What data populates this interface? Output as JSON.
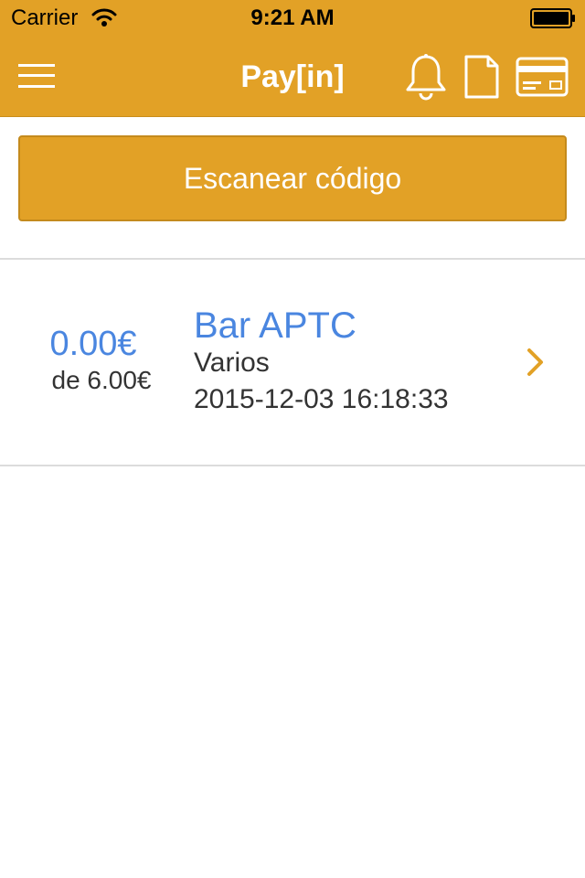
{
  "status_bar": {
    "carrier": "Carrier",
    "time": "9:21 AM",
    "icons": [
      "wifi-icon",
      "battery-icon"
    ]
  },
  "nav": {
    "title": "Pay[in]",
    "icons": [
      "menu-icon",
      "bell-icon",
      "document-icon",
      "credit-card-icon"
    ]
  },
  "scan_button": {
    "label": "Escanear código"
  },
  "payments": [
    {
      "paid": "0.00€",
      "total": "de 6.00€",
      "merchant": "Bar APTC",
      "category": "Varios",
      "datetime": "2015-12-03 16:18:33"
    }
  ],
  "colors": {
    "brand": "#e2a126",
    "accent_blue": "#4a86e0",
    "text_dark": "#333333",
    "divider": "#dcdcdc"
  }
}
